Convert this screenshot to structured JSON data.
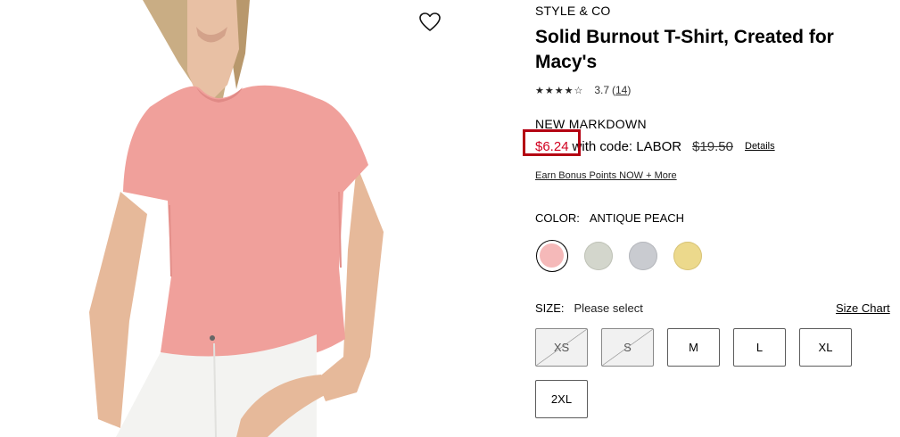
{
  "product": {
    "brand": "STYLE & CO",
    "title": "Solid Burnout T-Shirt, Created for Macy's",
    "stars_display": "★★★★☆",
    "rating": "3.7",
    "reviews_open": "(",
    "review_count": "14",
    "reviews_close": ")"
  },
  "price": {
    "label": "NEW MARKDOWN",
    "sale": "$6.24",
    "code_text": "with code: LABOR",
    "original": "$19.50",
    "details": "Details",
    "sale_color": "#d1001f"
  },
  "bonus_link": "Earn Bonus Points NOW + More",
  "color": {
    "label": "COLOR:",
    "selected": "ANTIQUE PEACH",
    "swatches": [
      {
        "name": "antique-peach",
        "hex": "#f5b9b9",
        "selected": true
      },
      {
        "name": "heather-sage",
        "hex": "#d3d6cc"
      },
      {
        "name": "heather-grey",
        "hex": "#c9cbd0"
      },
      {
        "name": "yellow",
        "hex": "#ecd98c"
      }
    ]
  },
  "size": {
    "label": "SIZE:",
    "selected": "Please select",
    "chart_link": "Size Chart",
    "options": [
      {
        "label": "XS",
        "available": false
      },
      {
        "label": "S",
        "available": false
      },
      {
        "label": "M",
        "available": true
      },
      {
        "label": "L",
        "available": true
      },
      {
        "label": "XL",
        "available": true
      },
      {
        "label": "2XL",
        "available": true
      }
    ]
  },
  "icons": {
    "wishlist": "heart-outline-icon"
  }
}
